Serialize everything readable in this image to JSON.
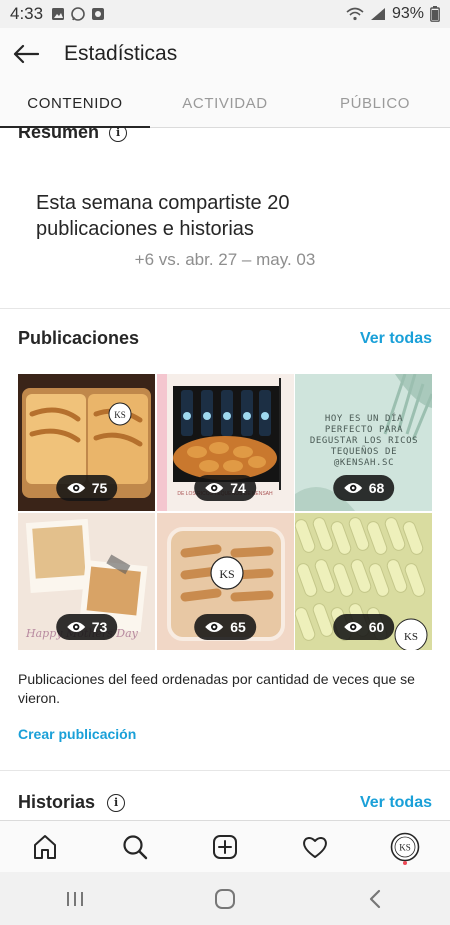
{
  "status_bar": {
    "time": "4:33",
    "battery": "93%"
  },
  "header": {
    "title": "Estadísticas"
  },
  "tabs": [
    {
      "label": "CONTENIDO",
      "active": true
    },
    {
      "label": "ACTIVIDAD",
      "active": false
    },
    {
      "label": "PÚBLICO",
      "active": false
    }
  ],
  "resumen": {
    "title": "Resumen",
    "text": "Esta semana compartiste 20 publicaciones e historias",
    "comparison": "+6 vs. abr. 27 – may. 03"
  },
  "publicaciones": {
    "title": "Publicaciones",
    "see_all": "Ver todas",
    "posts": [
      {
        "views": "75",
        "image": "pastries-in-container"
      },
      {
        "views": "74",
        "image": "bottles-and-fried-snacks",
        "text": "DE LOS RICOS TEQUEÑOS DE KENSAH"
      },
      {
        "views": "68",
        "image": "text-post-palm-leaf",
        "text": "HOY ES UN DÍA PERFECTO PARA DEGUSTAR LOS RICOS TEQUEÑOS DE @KENSAH.SC"
      },
      {
        "views": "73",
        "image": "mothers-day-polaroids",
        "text": "Happy Mothers Day"
      },
      {
        "views": "65",
        "image": "pastries-closeup-container"
      },
      {
        "views": "60",
        "image": "raw-tequenos-tray"
      }
    ],
    "caption": "Publicaciones del feed ordenadas por cantidad de veces que se vieron.",
    "create_link": "Crear publicación"
  },
  "historias": {
    "title": "Historias",
    "see_all": "Ver todas"
  },
  "colors": {
    "accent": "#1aa0d8",
    "text": "#262626",
    "muted": "#8e8e8e"
  },
  "bottom_nav": [
    "home-icon",
    "search-icon",
    "new-post-icon",
    "heart-icon",
    "profile-avatar"
  ],
  "system_nav": [
    "recents-icon",
    "home-circle-icon",
    "back-icon"
  ]
}
